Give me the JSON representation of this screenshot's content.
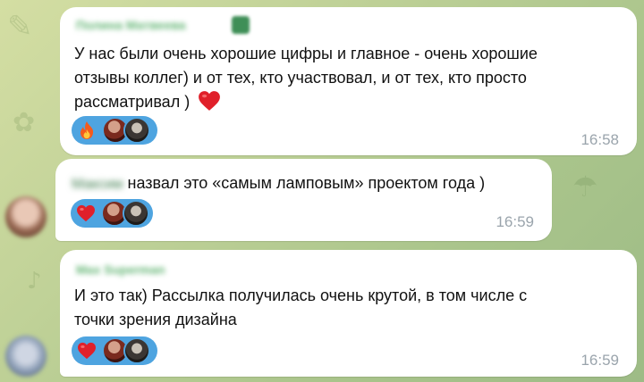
{
  "messages": [
    {
      "sender": "Полина Матвеева",
      "text_lines": [
        "У нас были очень хорошие цифры и главное - очень хорошие",
        "отзывы коллег) и от тех, кто участвовал, и от тех, кто просто",
        "рассматривал )"
      ],
      "emoji_after_text": "heart",
      "reaction": "fire",
      "time": "16:58"
    },
    {
      "sender": "Максим",
      "text": "назвал это «самым ламповым» проектом года )",
      "reaction": "heart",
      "time": "16:59"
    },
    {
      "sender": "Max Superman",
      "text_lines": [
        "И это так) Рассылка получилась очень крутой, в том числе с",
        "точки зрения дизайна"
      ],
      "reaction": "heart",
      "time": "16:59"
    }
  ],
  "colors": {
    "sender_name": "#63b574",
    "reaction_pill": "#4ea4e0",
    "time": "#9aa4ac",
    "heart": "#e0202a"
  }
}
